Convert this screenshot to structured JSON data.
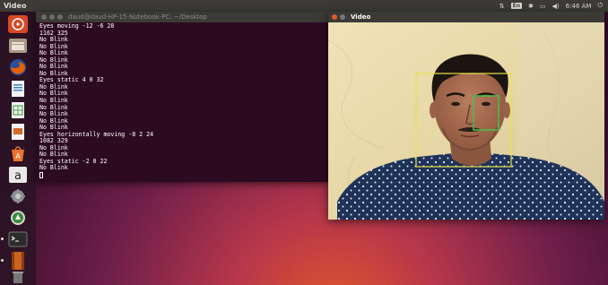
{
  "top_bar": {
    "app_title": "Video",
    "keyboard_indicator": "En",
    "clock": "6:46 AM"
  },
  "launcher": {
    "items": [
      {
        "name": "ubuntu-dash-icon",
        "color": "#d64a27"
      },
      {
        "name": "files-icon",
        "color": "#9a8a78"
      },
      {
        "name": "firefox-icon",
        "color": "#e66000"
      },
      {
        "name": "writer-icon",
        "color": "#3f86c8"
      },
      {
        "name": "calc-icon",
        "color": "#4aa84a"
      },
      {
        "name": "impress-icon",
        "color": "#d2692a"
      },
      {
        "name": "software-center-icon",
        "color": "#e8742c"
      },
      {
        "name": "amazon-icon",
        "color": "#e9e9e9"
      },
      {
        "name": "system-settings-icon",
        "color": "#8a8f95"
      },
      {
        "name": "software-updater-icon",
        "color": "#3a8a3a"
      },
      {
        "name": "terminal-icon",
        "color": "#2b2b2b"
      },
      {
        "name": "video-player-icon",
        "color": "#c9641e"
      },
      {
        "name": "trash-icon",
        "color": "#777777"
      }
    ]
  },
  "terminal": {
    "title": "daud@daud-HP-15-Notebook-PC: ~/Desktop",
    "lines": [
      "Eyes moving -12 -6 28",
      "1162 325",
      "No Blink",
      "No Blink",
      "No Blink",
      "No Blink",
      "No Blink",
      "No Blink",
      "Eyes static 4 0 32",
      "No Blink",
      "No Blink",
      "No Blink",
      "No Blink",
      "No Blink",
      "No Blink",
      "No Blink",
      "Eyes horizontally moving -8 2 24",
      "1082 329",
      "No Blink",
      "No Blink",
      "Eyes static -2 0 22",
      "No Blink"
    ]
  },
  "video_window": {
    "title": "Video"
  }
}
